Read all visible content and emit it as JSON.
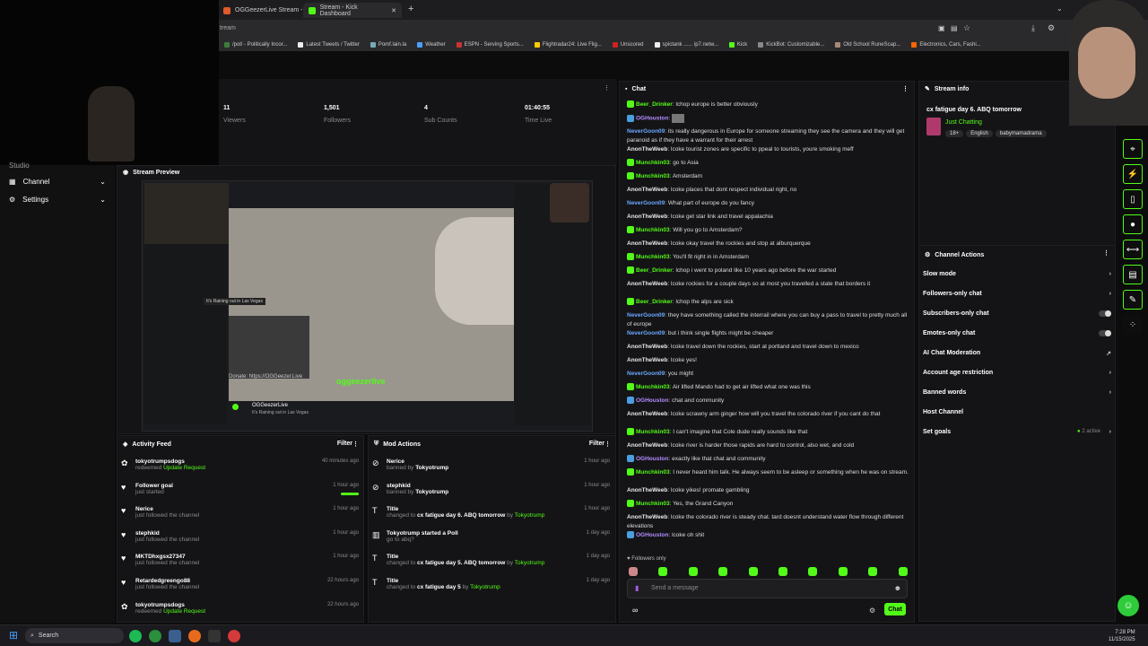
{
  "browser": {
    "tabs": [
      {
        "label": "OGGeezerLive Stream - Wa"
      },
      {
        "label": "Stream - Kick Dashboard"
      }
    ],
    "url_fragment": "tream",
    "bookmarks": [
      "/pol/ - Politically Incor...",
      "Latest Tweets / Twitter",
      "Pomf.lain.la",
      "Weather",
      "ESPN - Serving Sports...",
      "Flightradar24: Live Flig...",
      "Unscored",
      "spictank ...... ip7.netw...",
      "Kick",
      "KickBot: Customizable...",
      "Old School RuneScap...",
      "Electronics, Cars, Fashi..."
    ]
  },
  "nav": {
    "items": [
      {
        "label": "Studio"
      },
      {
        "label": "Channel"
      },
      {
        "label": "Settings"
      }
    ]
  },
  "stats": [
    {
      "value": "11",
      "label": "Viewers"
    },
    {
      "value": "1,501",
      "label": "Followers"
    },
    {
      "value": "4",
      "label": "Sub Counts"
    },
    {
      "value": "01:40:55",
      "label": "Time Live"
    }
  ],
  "preview": {
    "title": "Stream Preview",
    "donate": "Donate: https://OGGeezer.Live",
    "watermark": "oggeezerlive",
    "stream_name": "OGGeezerLive",
    "stream_sub": "It's Raining out in Las Vegas",
    "tooltip": "It's Raining out in Las Vegas"
  },
  "activity": {
    "title": "Activity Feed",
    "filter": "Filter",
    "items": [
      {
        "user": "tokyotrumpsdogs",
        "action": "redeemed",
        "extra": "Update Request",
        "time": "40 minutes ago"
      },
      {
        "user": "Follower goal",
        "action": "just started",
        "extra": "",
        "time": "1 hour ago"
      },
      {
        "user": "Nerice",
        "action": "just followed the channel",
        "extra": "",
        "time": "1 hour ago"
      },
      {
        "user": "stephkid",
        "action": "just followed the channel",
        "extra": "",
        "time": "1 hour ago"
      },
      {
        "user": "MKTDhxgsx27347",
        "action": "just followed the channel",
        "extra": "",
        "time": "1 hour ago"
      },
      {
        "user": "Retardedgreengo88",
        "action": "just followed the channel",
        "extra": "",
        "time": "22 hours ago"
      },
      {
        "user": "tokyotrumpsdogs",
        "action": "redeemed",
        "extra": "Update Request",
        "time": "22 hours ago"
      }
    ]
  },
  "mod": {
    "title": "Mod Actions",
    "filter": "Filter",
    "items": [
      {
        "head": "Nerice",
        "line": "banned by",
        "who": "Tokyotrump",
        "tail": "",
        "time": "1 hour ago"
      },
      {
        "head": "stephkid",
        "line": "banned by",
        "who": "Tokyotrump",
        "tail": "",
        "time": "1 hour ago"
      },
      {
        "head": "Title",
        "line": "changed to",
        "who": "cx fatigue day 6. ABQ tomorrow",
        "tail": "Tokyotrump",
        "time": "1 hour ago"
      },
      {
        "head": "Tokyotrump started a Poll",
        "line": "go to abq?",
        "who": "",
        "tail": "",
        "time": "1 day ago"
      },
      {
        "head": "Title",
        "line": "changed to",
        "who": "cx fatigue day 5. ABQ tomorrow",
        "tail": "Tokyotrump",
        "time": "1 day ago"
      },
      {
        "head": "Title",
        "line": "changed to",
        "who": "cx fatigue day 5",
        "tail": "Tokyotrump",
        "time": "1 day ago"
      }
    ]
  },
  "chat": {
    "title": "Chat",
    "followers_only": "Followers only",
    "placeholder": "Send a message",
    "send": "Chat",
    "messages": [
      {
        "user": "Beer_Drinker",
        "text": "lchop europe is better obviously"
      },
      {
        "user": "OGHouston",
        "text": ""
      },
      {
        "user": "NeverGoon09",
        "text": "its really dangerous in Europe for someone streaming they see the camera and they will get paranoid as if they have a warrant for their arrest"
      },
      {
        "user": "AnonTheWeeb",
        "text": "lcoke tourist zones are specific to ppeal to tourists, youre smoking meff"
      },
      {
        "user": "Munchkin03",
        "text": "go to Asia"
      },
      {
        "user": "Munchkin03",
        "text": "Amsterdam"
      },
      {
        "user": "AnonTheWeeb",
        "text": "lcoke places that dont respect individual right, no"
      },
      {
        "user": "NeverGoon09",
        "text": "What part of europe do you fancy"
      },
      {
        "user": "AnonTheWeeb",
        "text": "lcoke get star link and travel appalachia"
      },
      {
        "user": "Munchkin03",
        "text": "Will you go to Amsterdam?"
      },
      {
        "user": "AnonTheWeeb",
        "text": "lcoke okay travel the rockies and stop at alburquerque"
      },
      {
        "user": "Munchkin03",
        "text": "You'll fit right in in Amsterdam"
      },
      {
        "user": "Beer_Drinker",
        "text": "lchop i went to poland like 10 years ago before the war started"
      },
      {
        "user": "AnonTheWeeb",
        "text": "lcoke rockies for a couple days so at most you travelled a state that borders it"
      },
      {
        "user": "Beer_Drinker",
        "text": "lchop the alps are sick"
      },
      {
        "user": "NeverGoon09",
        "text": "they have something called the interrail where you can buy a pass to travel to pretty much all of europe"
      },
      {
        "user": "NeverGoon09",
        "text": "but i think single flights might be cheaper"
      },
      {
        "user": "AnonTheWeeb",
        "text": "lcoke travel down the rockies, start at portland and travel down to mexico"
      },
      {
        "user": "AnonTheWeeb",
        "text": "lcoke yes!"
      },
      {
        "user": "NeverGoon09",
        "text": "you might"
      },
      {
        "user": "Munchkin03",
        "text": "Air lifted Mando had to get air lifted what one was this"
      },
      {
        "user": "OGHouston",
        "text": "chat and community"
      },
      {
        "user": "AnonTheWeeb",
        "text": "lcoke scrawny arm ginger how will you travel the colorado river if you cant do that"
      },
      {
        "user": "Munchkin03",
        "text": "I can't imagine that Cole dude really sounds like that"
      },
      {
        "user": "AnonTheWeeb",
        "text": "lcoke river is harder those rapids are hard to control, also wet, and cold"
      },
      {
        "user": "OGHouston",
        "text": "exactly like that chat and community"
      },
      {
        "user": "Munchkin03",
        "text": "I never heard him talk. He always seem to be asleep or something when he was on stream."
      },
      {
        "user": "AnonTheWeeb",
        "text": "lcoke yikes! promate gambling"
      },
      {
        "user": "Munchkin03",
        "text": "Yes, the Grand Canyon"
      },
      {
        "user": "AnonTheWeeb",
        "text": "lcoke the colorado river is steady chat. tard doesnt understand water flow through different elevations"
      },
      {
        "user": "OGHouston",
        "text": "lcoke oh shit"
      }
    ]
  },
  "stream_info": {
    "title": "Stream info",
    "stream_title": "cx fatigue day 6. ABQ tomorrow",
    "category": "Just Chatting",
    "tags": [
      "18+",
      "English",
      "babymamadrama"
    ]
  },
  "channel_actions": {
    "title": "Channel Actions",
    "items": [
      "Slow mode",
      "Followers-only chat",
      "Subscribers-only chat",
      "Emotes-only chat",
      "AI Chat Moderation",
      "Account age restriction",
      "Banned words",
      "Host Channel",
      "Set goals"
    ],
    "goals_status": "2 active"
  },
  "taskbar": {
    "search": "Search",
    "time": "7:28 PM",
    "date": "11/15/2025"
  },
  "colors": {
    "accent": "#53fc18",
    "bg": "#0c0c0c",
    "panel": "#141416"
  }
}
